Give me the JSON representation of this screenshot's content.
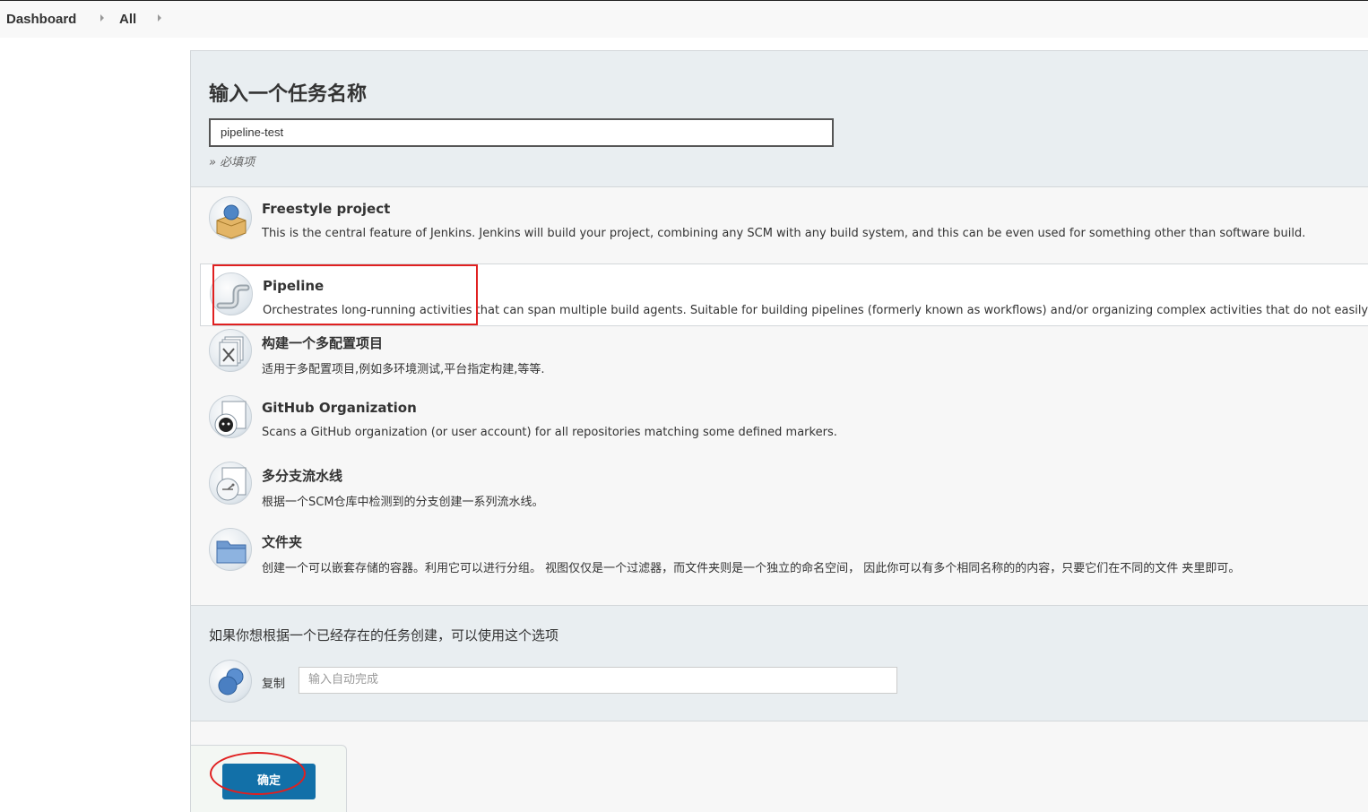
{
  "breadcrumbs": {
    "items": [
      {
        "label": "Dashboard"
      },
      {
        "label": "All"
      }
    ]
  },
  "form": {
    "title": "输入一个任务名称",
    "name_value": "pipeline-test",
    "required_hint": "» 必填项"
  },
  "job_types": [
    {
      "name": "Freestyle project",
      "description": "This is the central feature of Jenkins. Jenkins will build your project, combining any SCM with any build system, and this can be even used for something other than software build.",
      "icon": "freestyle-project-icon"
    },
    {
      "name": "Pipeline",
      "description": "Orchestrates long-running activities that can span multiple build agents. Suitable for building pipelines (formerly known as workflows) and/or organizing complex activities that do not easily fit in free-s",
      "icon": "pipeline-icon",
      "selected": true
    },
    {
      "name": "构建一个多配置项目",
      "description": "适用于多配置项目,例如多环境测试,平台指定构建,等等.",
      "icon": "multi-configuration-icon"
    },
    {
      "name": "GitHub Organization",
      "description": "Scans a GitHub organization (or user account) for all repositories matching some defined markers.",
      "icon": "github-icon"
    },
    {
      "name": "多分支流水线",
      "description": "根据一个SCM仓库中检测到的分支创建一系列流水线。",
      "icon": "multibranch-pipeline-icon"
    },
    {
      "name": "文件夹",
      "description": "创建一个可以嵌套存储的容器。利用它可以进行分组。 视图仅仅是一个过滤器，而文件夹则是一个独立的命名空间， 因此你可以有多个相同名称的的内容，只要它们在不同的文件 夹里即可。",
      "icon": "folder-icon"
    }
  ],
  "copy": {
    "label": "如果你想根据一个已经存在的任务创建，可以使用这个选项",
    "copy_word": "复制",
    "placeholder": "输入自动完成"
  },
  "footer": {
    "ok_label": "确定"
  },
  "colors": {
    "button": "#1270a8",
    "annotation": "#e02020",
    "header_bg": "#e9eef1"
  }
}
